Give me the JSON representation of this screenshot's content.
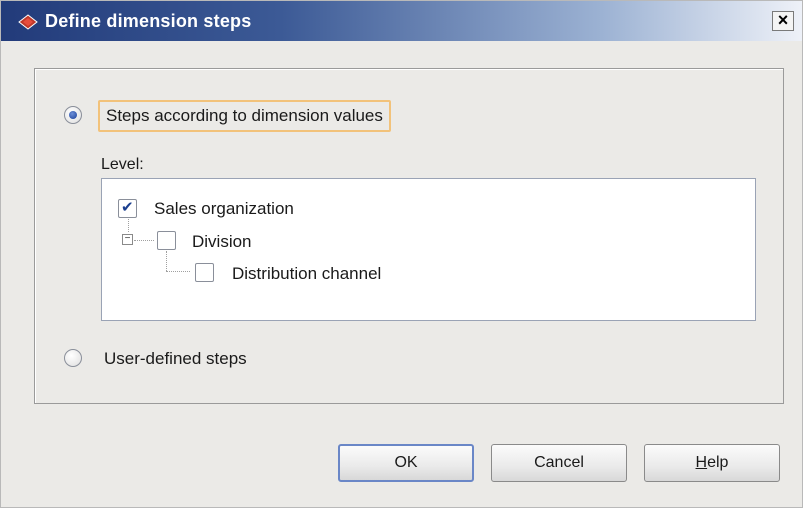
{
  "window": {
    "title": "Define dimension steps",
    "close_glyph": "×"
  },
  "options": {
    "dimension_values_label": "Steps according to dimension values",
    "user_defined_label": "User-defined steps",
    "selected": "dimension_values"
  },
  "level": {
    "label": "Level:",
    "items": [
      {
        "label": "Sales organization",
        "checked": true
      },
      {
        "label": "Division",
        "checked": false,
        "expanded": true
      },
      {
        "label": "Distribution channel",
        "checked": false
      }
    ]
  },
  "buttons": {
    "ok": "OK",
    "cancel": "Cancel",
    "help_mnemonic": "H",
    "help_rest": "elp"
  },
  "colors": {
    "title_bar": "#223b7a",
    "focus_border": "#f2c27a",
    "selected_radio": "#2a4fa5"
  },
  "icons": {
    "title": "app-icon",
    "close": "close-icon",
    "check": "checkmark-icon",
    "expander": "minus-expander-icon"
  }
}
